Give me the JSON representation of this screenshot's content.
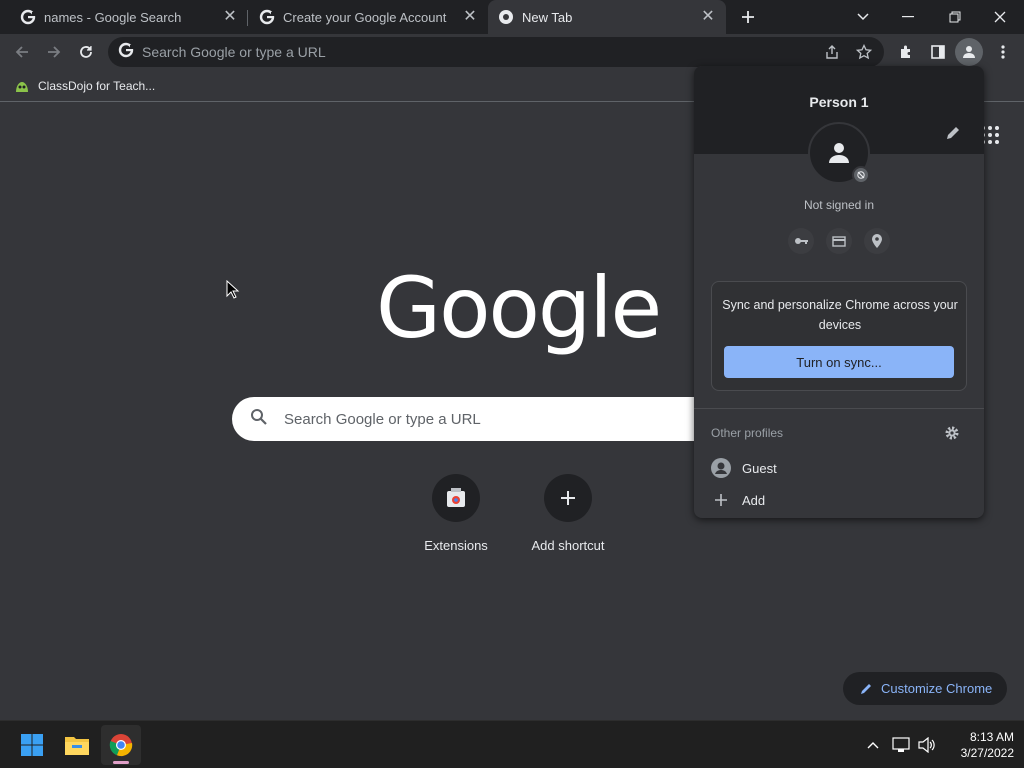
{
  "tabs": [
    {
      "title": "names - Google Search",
      "active": false
    },
    {
      "title": "Create your Google Account",
      "active": false
    },
    {
      "title": "New Tab",
      "active": true
    }
  ],
  "omnibox": {
    "placeholder": "Search Google or type a URL"
  },
  "bookmarks": [
    {
      "label": "ClassDojo for Teach..."
    }
  ],
  "ntp": {
    "logo_text": "Google",
    "search_placeholder": "Search Google or type a URL",
    "shortcuts": [
      {
        "label": "Extensions"
      },
      {
        "label": "Add shortcut"
      }
    ],
    "customize_label": "Customize Chrome"
  },
  "profile_menu": {
    "name": "Person 1",
    "status": "Not signed in",
    "sync_text": "Sync and personalize Chrome across your devices",
    "sync_button": "Turn on sync...",
    "other_profiles_label": "Other profiles",
    "profiles": [
      {
        "label": "Guest"
      },
      {
        "label": "Add"
      }
    ]
  },
  "taskbar": {
    "time": "8:13 AM",
    "date": "3/27/2022"
  },
  "colors": {
    "accent": "#8ab4f8",
    "background": "#35363a",
    "surface": "#202124"
  }
}
